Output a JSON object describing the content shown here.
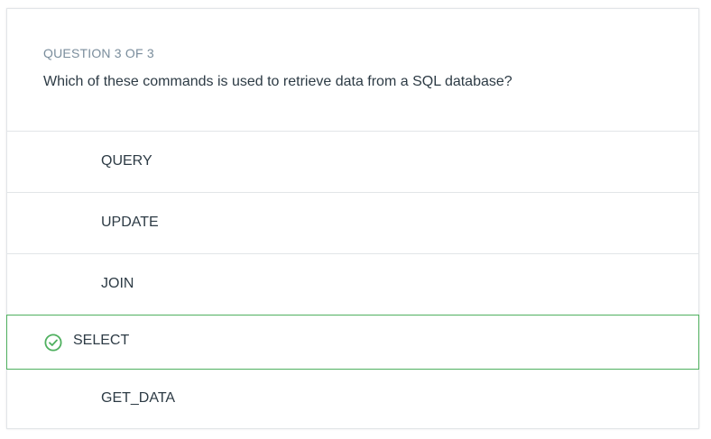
{
  "question": {
    "counter": "QUESTION 3 OF 3",
    "text": "Which of these commands is used to retrieve data from a SQL database?"
  },
  "answers": [
    {
      "label": "QUERY",
      "correct": false
    },
    {
      "label": "UPDATE",
      "correct": false
    },
    {
      "label": "JOIN",
      "correct": false
    },
    {
      "label": "SELECT",
      "correct": true
    },
    {
      "label": "GET_DATA",
      "correct": false
    }
  ],
  "colors": {
    "correct": "#4fb05f",
    "counter": "#7a8d9c",
    "text": "#2d3b45",
    "border": "#e2e5e8"
  },
  "icons": {
    "correct_indicator": "check-circle-icon"
  }
}
